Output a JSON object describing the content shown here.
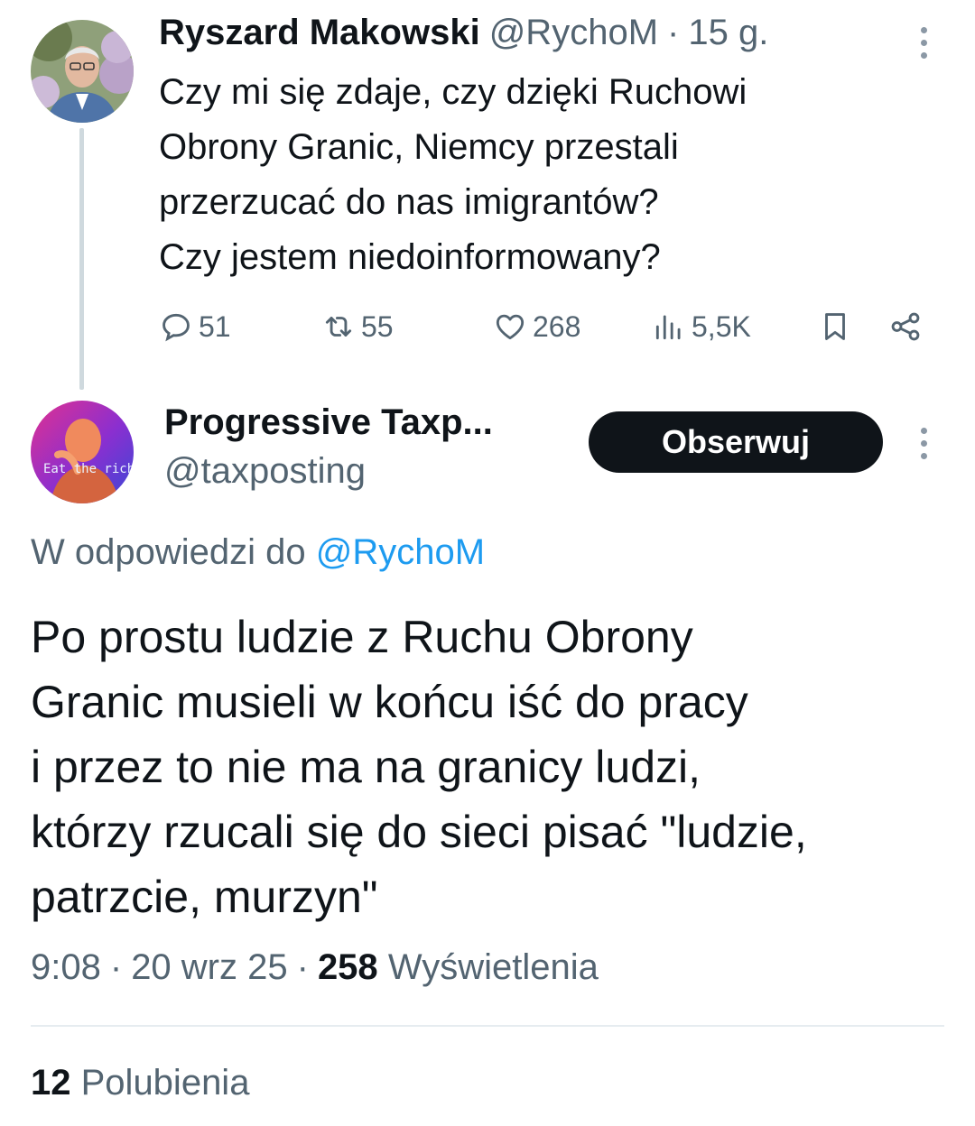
{
  "parent_tweet": {
    "author_name": "Ryszard Makowski",
    "handle": "@RychoM",
    "separator": "·",
    "time": "15 g.",
    "lines": [
      "Czy mi się zdaje, czy dzięki Ruchowi",
      "Obrony Granic, Niemcy przestali",
      "przerzucać do nas imigrantów?",
      "Czy jestem niedoinformowany?"
    ],
    "actions": {
      "replies": "51",
      "retweets": "55",
      "likes": "268",
      "views": "5,5K"
    }
  },
  "reply_tweet": {
    "author_name": "Progressive Taxp...",
    "handle": "@taxposting",
    "follow_label": "Obserwuj",
    "avatar_text": "Eat the rich",
    "reply_prefix": "W odpowiedzi do",
    "reply_to": "@RychoM",
    "lines": [
      "Po prostu ludzie z Ruchu Obrony",
      "Granic musieli w końcu iść do pracy",
      "i przez to nie ma na granicy ludzi,",
      "którzy rzucali się do sieci pisać \"ludzie,",
      "patrzcie, murzyn\""
    ],
    "time": "9:08",
    "date": "20 wrz 25",
    "separator": "·",
    "views_count": "258",
    "views_label": "Wyświetlenia",
    "likes_count": "12",
    "likes_label": "Polubienia"
  },
  "colors": {
    "text": "#0f1419",
    "muted": "#536471",
    "link": "#1d9bf0",
    "button_bg": "#0f1419",
    "divider": "#cfd9de"
  }
}
